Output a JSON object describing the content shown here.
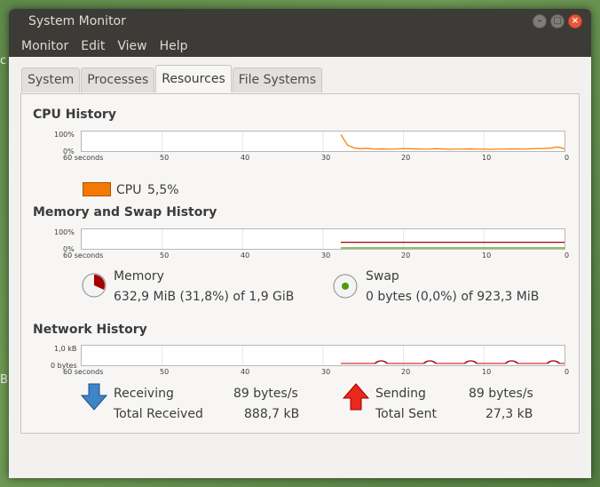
{
  "desktop": {
    "left_letter_1": "c",
    "left_letter_2": "B"
  },
  "window": {
    "title": "System Monitor"
  },
  "menu": [
    "Monitor",
    "Edit",
    "View",
    "Help"
  ],
  "tabs": [
    "System",
    "Processes",
    "Resources",
    "File Systems"
  ],
  "active_tab": "Resources",
  "cpu": {
    "title": "CPU History",
    "y_top": "100%",
    "y_bottom": "0%",
    "x_ticks": [
      "60 seconds",
      "50",
      "40",
      "30",
      "20",
      "10",
      "0"
    ],
    "legend_label": "CPU",
    "legend_value": "5,5%",
    "color": "#f57900",
    "series_percent": [
      88,
      28,
      12,
      8,
      10,
      6,
      7,
      6,
      6,
      9,
      8,
      7,
      6,
      6,
      8,
      7,
      5,
      6,
      6,
      7,
      6,
      6,
      5,
      6,
      6,
      7,
      7,
      6,
      8,
      9,
      10,
      12,
      18,
      8
    ]
  },
  "memory": {
    "title": "Memory and Swap History",
    "y_top": "100%",
    "y_bottom": "0%",
    "x_ticks": [
      "60 seconds",
      "50",
      "40",
      "30",
      "20",
      "10",
      "0"
    ],
    "memory_label": "Memory",
    "memory_value": "632,9 MiB (31,8%) of 1,9 GiB",
    "memory_color": "#a40000",
    "memory_percent": 31.8,
    "swap_label": "Swap",
    "swap_value": "0 bytes (0,0%) of 923,3 MiB",
    "swap_color": "#4e9a06",
    "swap_percent": 0.0
  },
  "network": {
    "title": "Network History",
    "y_top": "1,0 kB",
    "y_bottom": "0 bytes",
    "x_ticks": [
      "60 seconds",
      "50",
      "40",
      "30",
      "20",
      "10",
      "0"
    ],
    "receiving_label": "Receiving",
    "receiving_rate": "89 bytes/s",
    "total_received_label": "Total Received",
    "total_received": "888,7 kB",
    "sending_label": "Sending",
    "sending_rate": "89 bytes/s",
    "total_sent_label": "Total Sent",
    "total_sent": "27,3 kB",
    "receive_color": "#3465a4",
    "send_color": "#cc0000"
  }
}
